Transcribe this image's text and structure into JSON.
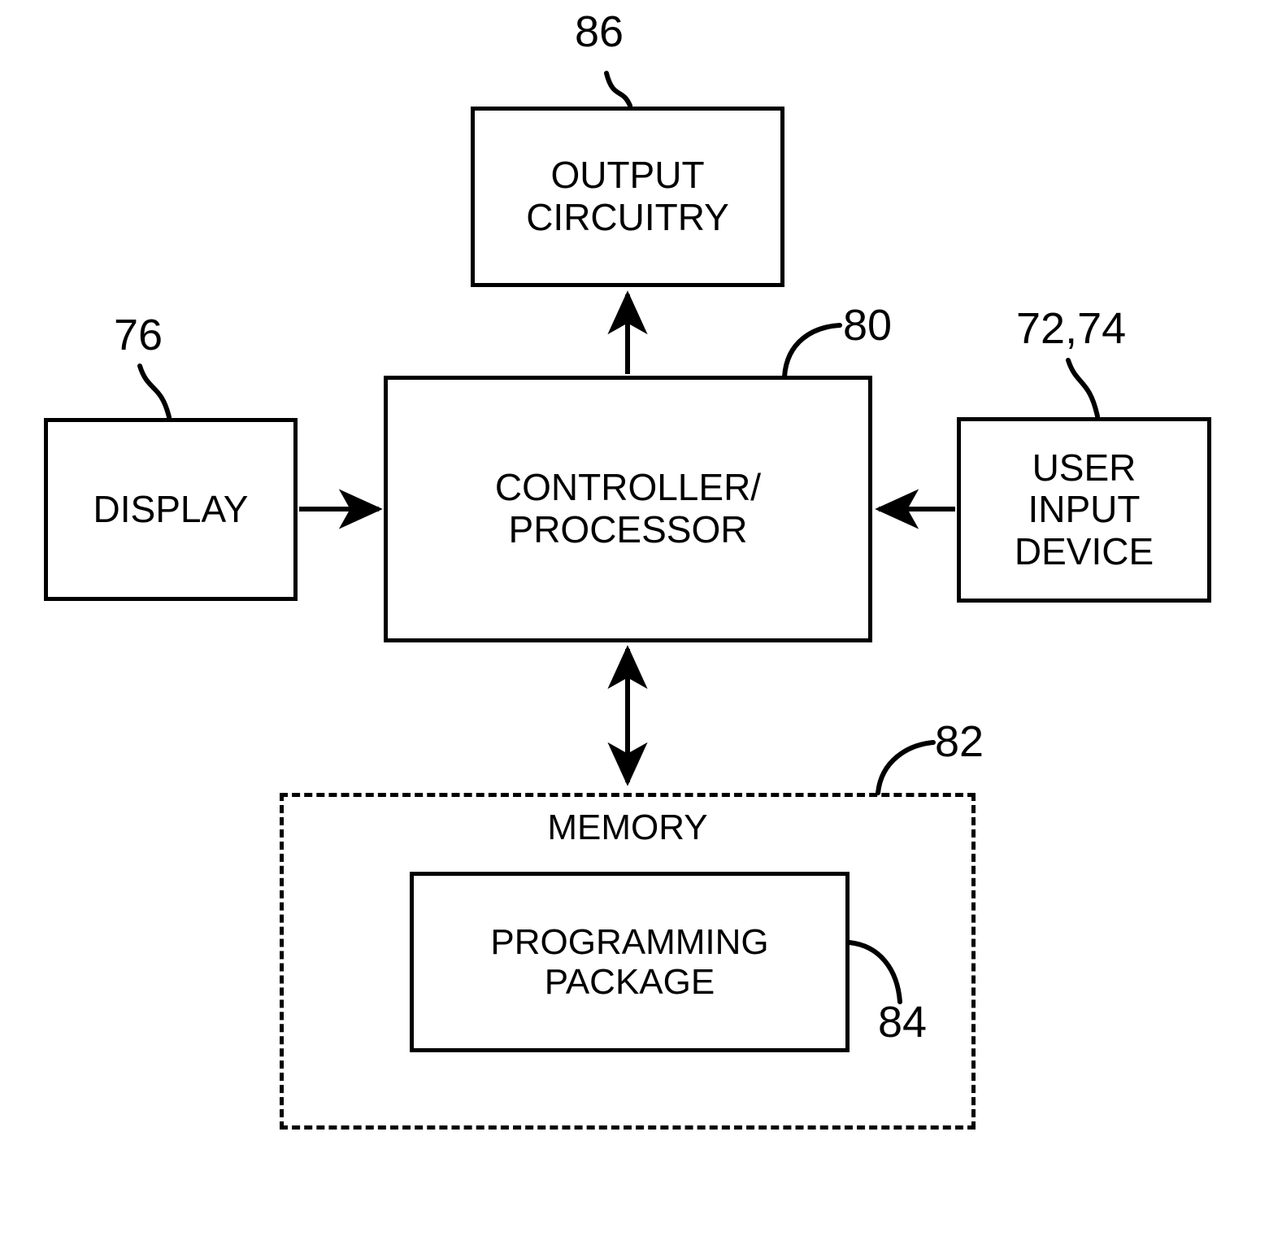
{
  "figure": {
    "type": "patent-block-diagram",
    "background_color": "#ffffff",
    "line_color": "#000000"
  },
  "nodes": {
    "output_circuitry": {
      "label": "OUTPUT\nCIRCUITRY",
      "ref": "86",
      "border": "solid"
    },
    "controller": {
      "label": "CONTROLLER/\nPROCESSOR",
      "ref": "80",
      "border": "solid"
    },
    "display": {
      "label": "DISPLAY",
      "ref": "76",
      "border": "solid"
    },
    "user_input_device": {
      "label": "USER\nINPUT\nDEVICE",
      "ref": "72,74",
      "border": "solid"
    },
    "memory": {
      "label": "MEMORY",
      "ref": "82",
      "border": "dashed"
    },
    "programming_package": {
      "label": "PROGRAMMING\nPACKAGE",
      "ref": "84",
      "border": "solid"
    }
  },
  "connections": [
    {
      "name": "display-to-controller",
      "from": "display",
      "to": "controller",
      "direction": "one-way",
      "orientation": "horizontal"
    },
    {
      "name": "user-input-to-controller",
      "from": "user_input_device",
      "to": "controller",
      "direction": "one-way",
      "orientation": "horizontal"
    },
    {
      "name": "controller-to-output",
      "from": "controller",
      "to": "output_circuitry",
      "direction": "one-way",
      "orientation": "vertical"
    },
    {
      "name": "controller-to-memory",
      "from": "controller",
      "to": "memory",
      "direction": "two-way",
      "orientation": "vertical"
    }
  ],
  "reference_numerals": [
    {
      "name": "ref-86",
      "value": "86",
      "points_to": "output_circuitry"
    },
    {
      "name": "ref-80",
      "value": "80",
      "points_to": "controller"
    },
    {
      "name": "ref-76",
      "value": "76",
      "points_to": "display"
    },
    {
      "name": "ref-72-74",
      "value": "72,74",
      "points_to": "user_input_device"
    },
    {
      "name": "ref-82",
      "value": "82",
      "points_to": "memory"
    },
    {
      "name": "ref-84",
      "value": "84",
      "points_to": "programming_package"
    }
  ]
}
